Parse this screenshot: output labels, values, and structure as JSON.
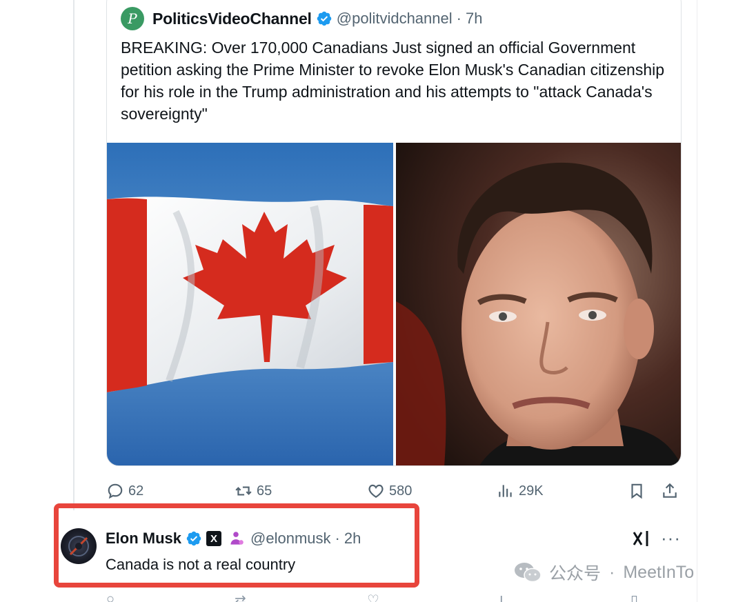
{
  "quoted_post": {
    "author_name": "PoliticsVideoChannel",
    "avatar_letter": "P",
    "handle": "@politvidchannel",
    "separator": "·",
    "time": "7h",
    "text": "BREAKING: Over 170,000 Canadians Just signed an official Government petition asking the Prime Minister to revoke Elon Musk's Canadian citizenship for his role in the Trump administration and his attempts to \"attack Canada's sovereignty\"",
    "images": [
      "canada-flag-photo",
      "elon-musk-portrait-photo"
    ]
  },
  "actions": {
    "replies": "62",
    "reposts": "65",
    "likes": "580",
    "views": "29K"
  },
  "reply": {
    "author_name": "Elon Musk",
    "x_badge": "X",
    "handle": "@elonmusk",
    "separator": "·",
    "time": "2h",
    "text": "Canada is not a real country"
  },
  "watermark": {
    "label": "公众号",
    "separator": "·",
    "account": "MeetInTo"
  },
  "colors": {
    "verified_blue": "#1d9bf0",
    "highlight_red": "#e8453c",
    "muted_text": "#536471",
    "avatar_green": "#3a9a63"
  },
  "icons": [
    "verified-icon",
    "reply-icon",
    "repost-icon",
    "like-icon",
    "views-icon",
    "bookmark-icon",
    "share-icon",
    "x-badge-icon",
    "affiliate-icon",
    "grok-icon",
    "more-icon",
    "wechat-icon"
  ]
}
